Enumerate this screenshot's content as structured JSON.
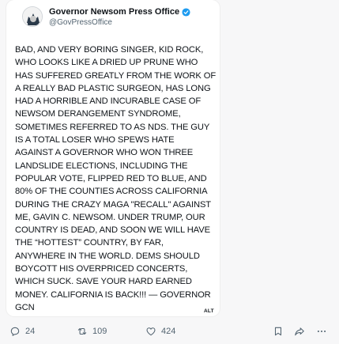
{
  "tweet": {
    "display_name": "Governor Newsom Press Office",
    "handle": "@GovPressOffice",
    "lines": [
      "BAD, AND VERY BORING SINGER, KID ROCK,",
      "WHO LOOKS LIKE A DRIED UP PRUNE WHO",
      "HAS SUFFERED GREATLY FROM THE WORK OF",
      "A REALLY BAD PLASTIC SURGEON, HAS LONG",
      "HAD A HORRIBLE AND INCURABLE CASE OF",
      "NEWSOM DERANGEMENT SYNDROME,",
      "SOMETIMES REFERRED TO AS NDS. THE GUY",
      "IS A TOTAL LOSER WHO SPEWS HATE",
      "AGAINST A GOVERNOR WHO WON THREE",
      "LANDSLIDE ELECTIONS, INCLUDING THE",
      "POPULAR VOTE, FLIPPED RED TO BLUE, AND",
      "80% OF THE COUNTIES ACROSS CALIFORNIA",
      "DURING THE CRAZY MAGA \"RECALL\" AGAINST",
      "ME, GAVIN C. NEWSOM. UNDER TRUMP, OUR",
      "COUNTRY IS DEAD, AND SOON WE WILL HAVE",
      "THE “HOTTEST” COUNTRY, BY FAR,",
      "ANYWHERE IN THE WORLD. DEMS SHOULD",
      "BOYCOTT HIS OVERPRICED CONCERTS,",
      "WHICH SUCK. SAVE YOUR HARD EARNED",
      "MONEY. CALIFORNIA IS BACK!!! — GOVERNOR",
      "GCN"
    ],
    "alt_badge": "ALT"
  },
  "actions": {
    "replies": "24",
    "retweets": "109",
    "likes": "424"
  },
  "colors": {
    "verified": "#1d9bf0",
    "muted": "#536471",
    "text": "#0f1419"
  },
  "icons": [
    "verified-badge-icon",
    "reply-icon",
    "retweet-icon",
    "like-icon",
    "bookmark-icon",
    "share-icon",
    "more-icon"
  ]
}
